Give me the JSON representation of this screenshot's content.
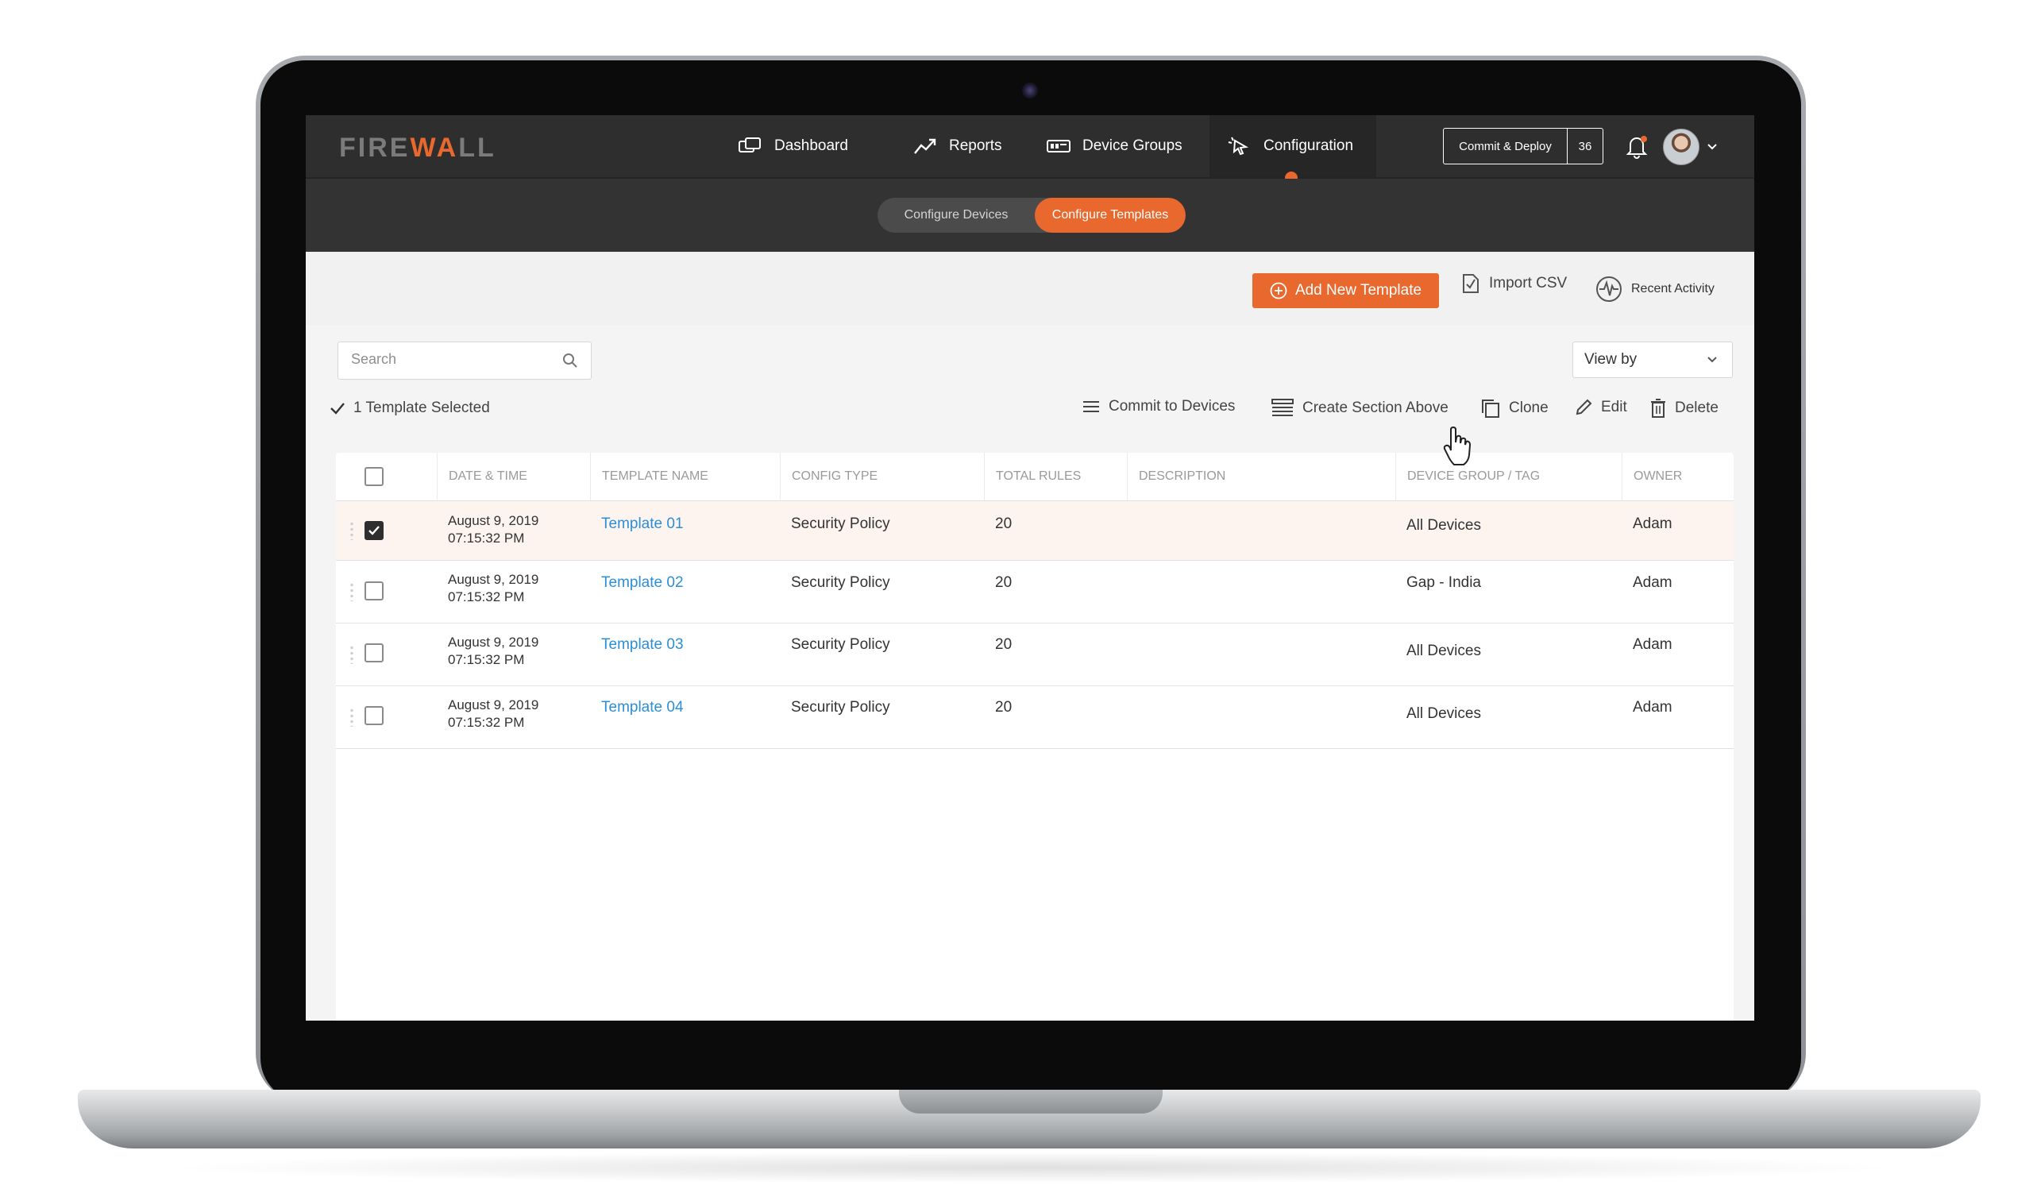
{
  "brand": {
    "logo_left": "FIRE",
    "logo_right": "WA",
    "logo_end": "LL"
  },
  "nav": {
    "items": [
      {
        "label": "Dashboard",
        "icon": "dashboard-icon"
      },
      {
        "label": "Reports",
        "icon": "trend-icon"
      },
      {
        "label": "Device Groups",
        "icon": "device-groups-icon"
      },
      {
        "label": "Configuration",
        "icon": "configuration-icon",
        "active": true
      }
    ],
    "commit_label": "Commit & Deploy",
    "commit_count": "36"
  },
  "subnav": {
    "tabs": [
      "Configure Devices",
      "Configure Templates"
    ],
    "active": "Configure Templates"
  },
  "actions": {
    "add_label": "Add New Template",
    "import_label": "Import CSV",
    "activity_label": "Recent Activity"
  },
  "search": {
    "placeholder": "Search",
    "value": ""
  },
  "view_by": {
    "label": "View by"
  },
  "selection": {
    "text": "1 Template Selected"
  },
  "toolbar": {
    "commit_label": "Commit to Devices",
    "section_label": "Create Section Above",
    "clone_label": "Clone",
    "edit_label": "Edit",
    "delete_label": "Delete"
  },
  "table": {
    "columns": [
      "DATE & TIME",
      "TEMPLATE NAME",
      "CONFIG TYPE",
      "TOTAL RULES",
      "DESCRIPTION",
      "DEVICE GROUP / TAG",
      "OWNER"
    ],
    "rows": [
      {
        "date": "August 9, 2019",
        "time": "07:15:32 PM",
        "name": "Template 01",
        "type": "Security Policy",
        "rules": "20",
        "description": "",
        "group": "All Devices",
        "owner": "Adam",
        "checked": true
      },
      {
        "date": "August 9, 2019",
        "time": "07:15:32 PM",
        "name": "Template 02",
        "type": "Security Policy",
        "rules": "20",
        "description": "",
        "group": "Gap - India",
        "owner": "Adam",
        "checked": false
      },
      {
        "date": "August 9, 2019",
        "time": "07:15:32 PM",
        "name": "Template 03",
        "type": "Security Policy",
        "rules": "20",
        "description": "",
        "group": "All Devices",
        "owner": "Adam",
        "checked": false
      },
      {
        "date": "August 9, 2019",
        "time": "07:15:32 PM",
        "name": "Template 04",
        "type": "Security Policy",
        "rules": "20",
        "description": "",
        "group": "All Devices",
        "owner": "Adam",
        "checked": false
      }
    ]
  },
  "colors": {
    "accent": "#e8682e",
    "link": "#2b8fd6",
    "topbar": "#2e2e2e"
  }
}
